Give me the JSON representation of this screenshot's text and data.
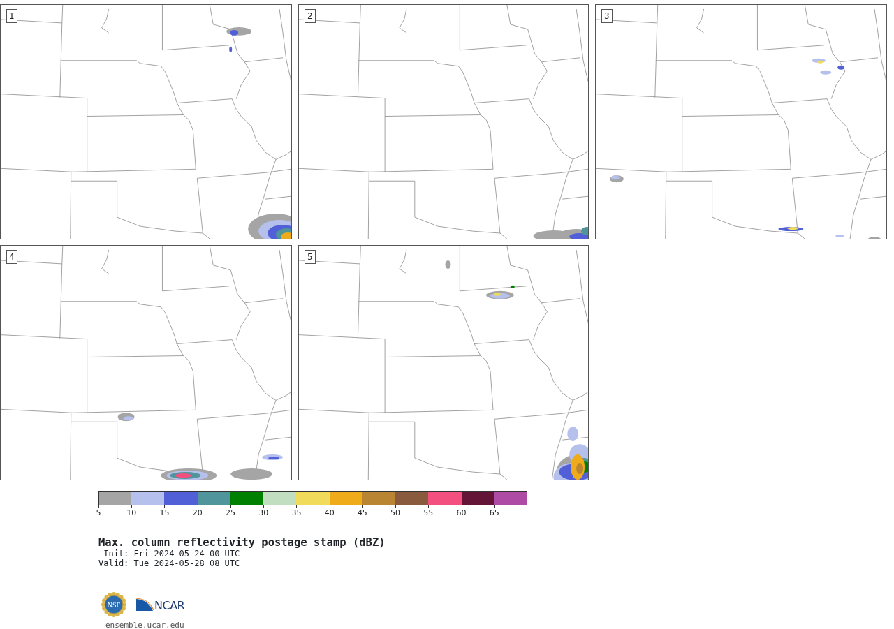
{
  "panels": [
    {
      "number": "1"
    },
    {
      "number": "2"
    },
    {
      "number": "3"
    },
    {
      "number": "4"
    },
    {
      "number": "5"
    }
  ],
  "colorbar": {
    "bins": [
      {
        "color": "#a5a5a5"
      },
      {
        "color": "#b6c0ec"
      },
      {
        "color": "#5160d6"
      },
      {
        "color": "#4f959b"
      },
      {
        "color": "#008000"
      },
      {
        "color": "#c1dfc0"
      },
      {
        "color": "#f0db5a"
      },
      {
        "color": "#efab19"
      },
      {
        "color": "#b98532"
      },
      {
        "color": "#8a5a3e"
      },
      {
        "color": "#f4507f"
      },
      {
        "color": "#641537"
      },
      {
        "color": "#ae4ba5"
      }
    ],
    "ticks": [
      "5",
      "10",
      "15",
      "20",
      "25",
      "30",
      "35",
      "40",
      "45",
      "50",
      "55",
      "60",
      "65"
    ]
  },
  "title": "Max. column reflectivity postage stamp (dBZ)",
  "init": " Init: Fri 2024-05-24 00 UTC",
  "valid": "Valid: Tue 2024-05-28 08 UTC",
  "logos": {
    "nsf": "NSF",
    "ncar": "NCAR"
  },
  "url": "ensemble.ucar.edu"
}
